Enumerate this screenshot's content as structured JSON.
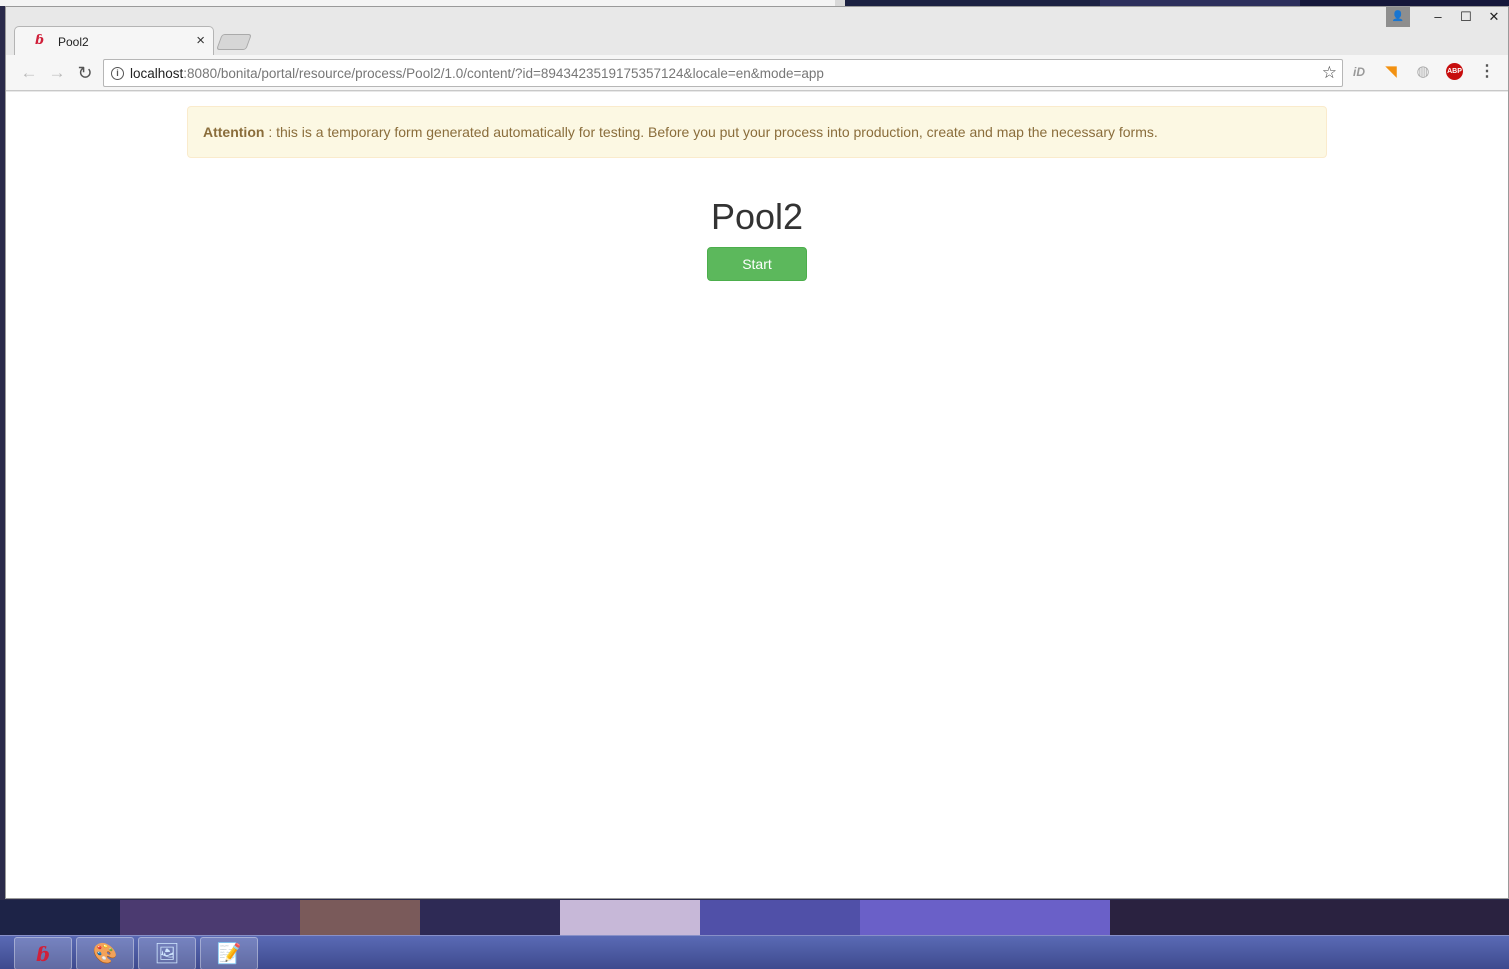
{
  "browser": {
    "tab": {
      "title": "Pool2",
      "close_glyph": "×",
      "favicon_glyph": "ɓ"
    },
    "window_controls": {
      "minimize": "–",
      "maximize": "☐",
      "close": "✕",
      "user": "👤"
    },
    "toolbar": {
      "back_glyph": "←",
      "forward_glyph": "→",
      "reload_glyph": "↻",
      "info_glyph": "i",
      "url_host": "localhost",
      "url_path": ":8080/bonita/portal/resource/process/Pool2/1.0/content/?id=8943423519175357124&locale=en&mode=app",
      "bookmark_glyph": "☆",
      "extensions": {
        "id": "iD",
        "rss": "◥",
        "globe": "◍",
        "abp": "ABP",
        "menu": "⋮"
      }
    }
  },
  "page": {
    "alert": {
      "strong": "Attention",
      "message": " : this is a temporary form generated automatically for testing. Before you put your process into production, create and map the necessary forms."
    },
    "title": "Pool2",
    "start_button": "Start"
  },
  "taskbar": {
    "items": [
      "ɓ",
      "🎨",
      "🖼",
      "📝"
    ]
  },
  "colors": {
    "alert_bg": "#fcf8e3",
    "alert_text": "#8a6d3b",
    "start_button": "#5cb85c"
  }
}
